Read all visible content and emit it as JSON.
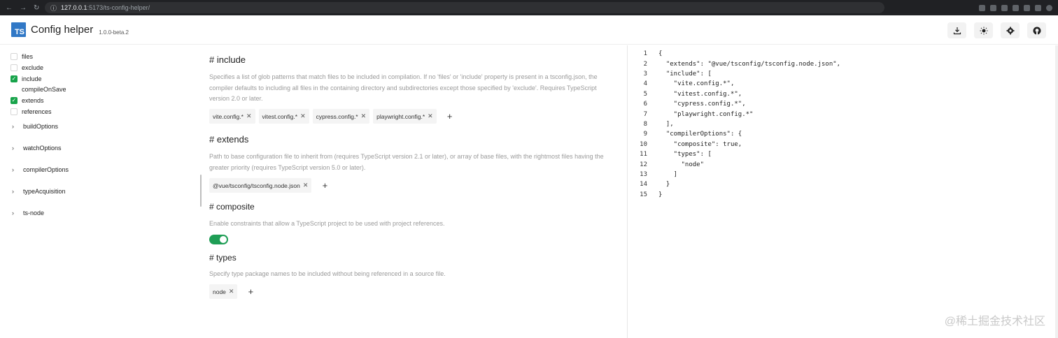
{
  "browser": {
    "url_host": "127.0.0.1",
    "url_path": ":5173/ts-config-helper/"
  },
  "header": {
    "logo_text": "TS",
    "title": "Config helper",
    "version": "1.0.0-beta.2"
  },
  "sidebar": {
    "options": [
      {
        "label": "files",
        "checked": false
      },
      {
        "label": "exclude",
        "checked": false
      },
      {
        "label": "include",
        "checked": true
      },
      {
        "label": "compileOnSave",
        "checked": null
      },
      {
        "label": "extends",
        "checked": true
      },
      {
        "label": "references",
        "checked": false
      }
    ],
    "groups": [
      "buildOptions",
      "watchOptions",
      "compilerOptions",
      "typeAcquisition",
      "ts-node"
    ]
  },
  "sections": {
    "include": {
      "title": "# include",
      "description": "Specifies a list of glob patterns that match files to be included in compilation. If no 'files' or 'include' property is present in a tsconfig.json, the compiler defaults to including all files in the containing directory and subdirectories except those specified by 'exclude'. Requires TypeScript version 2.0 or later.",
      "items": [
        "vite.config.*",
        "vitest.config.*",
        "cypress.config.*",
        "playwright.config.*"
      ]
    },
    "extends": {
      "title": "# extends",
      "description": "Path to base configuration file to inherit from (requires TypeScript version 2.1 or later), or array of base files, with the rightmost files having the greater priority (requires TypeScript version 5.0 or later).",
      "items": [
        "@vue/tsconfig/tsconfig.node.json"
      ]
    },
    "composite": {
      "title": "# composite",
      "description": "Enable constraints that allow a TypeScript project to be used with project references.",
      "enabled": true
    },
    "types": {
      "title": "# types",
      "description": "Specify type package names to be included without being referenced in a source file.",
      "items": [
        "node"
      ]
    }
  },
  "code": {
    "lines": [
      "{",
      "  \"extends\": \"@vue/tsconfig/tsconfig.node.json\",",
      "  \"include\": [",
      "    \"vite.config.*\",",
      "    \"vitest.config.*\",",
      "    \"cypress.config.*\",",
      "    \"playwright.config.*\"",
      "  ],",
      "  \"compilerOptions\": {",
      "    \"composite\": true,",
      "    \"types\": [",
      "      \"node\"",
      "    ]",
      "  }",
      "}"
    ]
  },
  "watermark": "@稀土掘金技术社区",
  "icons": [
    "download-icon",
    "sun-icon",
    "gear-icon",
    "github-icon",
    "close-icon",
    "plus-icon",
    "chevron-right-icon",
    "check-icon"
  ]
}
